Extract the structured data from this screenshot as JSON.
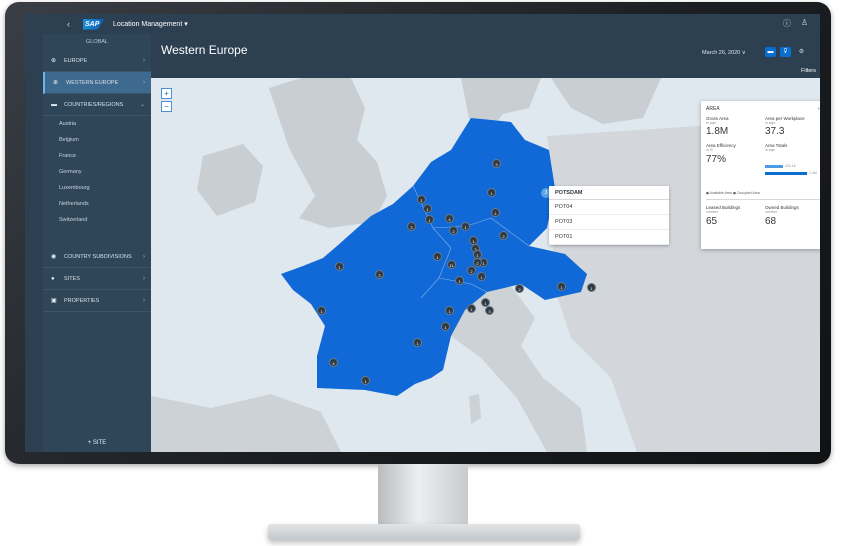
{
  "shell": {
    "app_title": "Location Management ▾",
    "logo_text": "SAP"
  },
  "sidebar": {
    "global_label": "GLOBAL",
    "items": [
      {
        "label": "EUROPE"
      },
      {
        "label": "WESTERN EUROPE"
      },
      {
        "label": "COUNTRIES/REGIONS"
      }
    ],
    "countries": [
      "Austria",
      "Belgium",
      "France",
      "Germany",
      "Luxembourg",
      "Netherlands",
      "Switzerland"
    ],
    "lower_items": [
      {
        "label": "COUNTRY SUBDIVISIONS"
      },
      {
        "label": "SITES"
      },
      {
        "label": "PROPERTIES"
      }
    ],
    "add_label": "+  SITE"
  },
  "header": {
    "page_title": "Western Europe",
    "date": "March 26, 2020 ∨",
    "filters_label": "Filters"
  },
  "map": {
    "zoom_in": "+",
    "zoom_out": "−",
    "pins": [
      "3",
      "1",
      "1",
      "1",
      "1",
      "4",
      "1",
      "2",
      "1",
      "3",
      "2",
      "1",
      "3",
      "1",
      "11",
      "1",
      "1",
      "1",
      "2",
      "3",
      "2",
      "1",
      "1",
      "2",
      "1",
      "1",
      "1",
      "1",
      "1",
      "1",
      "3",
      "1",
      "1",
      "4",
      "1"
    ],
    "popup": {
      "title": "POTSDAM",
      "rows": [
        "POT04",
        "POT03",
        "POT01"
      ]
    }
  },
  "area_card": {
    "title": "AREA",
    "gross_area": {
      "label": "Gross Area",
      "unit": "in sqm",
      "value": "1.8M"
    },
    "area_per_workplace": {
      "label": "Area per Workplace",
      "unit": "in sqm",
      "value": "37.3"
    },
    "area_efficiency": {
      "label": "Area Efficiency",
      "unit": "in %",
      "value": "77%"
    },
    "area_totals": {
      "label": "Area Totals",
      "unit": "in sqm",
      "bar1_label": "422.1k",
      "bar2_label": "1.4M"
    },
    "legend": "◼ Available Area   ◼ Occupied Area",
    "leased_buildings": {
      "label": "Leased Buildings",
      "unit": "number",
      "value": "65"
    },
    "owned_buildings": {
      "label": "Owned Buildings",
      "unit": "number",
      "value": "68"
    }
  },
  "colors": {
    "shell": "#2c4052",
    "sidebar": "#2f4659",
    "highlight_region": "#1069d6",
    "map_background": "#dfe7ef"
  }
}
